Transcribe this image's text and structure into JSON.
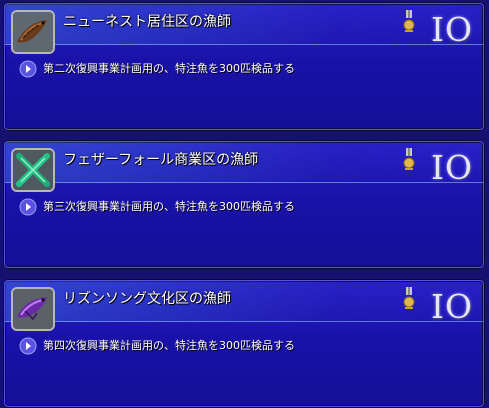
{
  "quests": [
    {
      "title": "ニューネスト居住区の漁師",
      "level_glyph": "IO",
      "objective": "第二次復興事業計画用の、特注魚を300匹検品する",
      "thumb_icon": "fish-icon-brown"
    },
    {
      "title": "フェザーフォール商業区の漁師",
      "level_glyph": "IO",
      "objective": "第三次復興事業計画用の、特注魚を300匹検品する",
      "thumb_icon": "crossed-blades-icon-green"
    },
    {
      "title": "リズンソング文化区の漁師",
      "level_glyph": "IO",
      "objective": "第四次復興事業計画用の、特注魚を300匹検品する",
      "thumb_icon": "fish-icon-purple"
    }
  ],
  "colors": {
    "panel": "#1a12a8",
    "bullet": "#5b52e0",
    "medal_gold": "#e0b84a"
  }
}
